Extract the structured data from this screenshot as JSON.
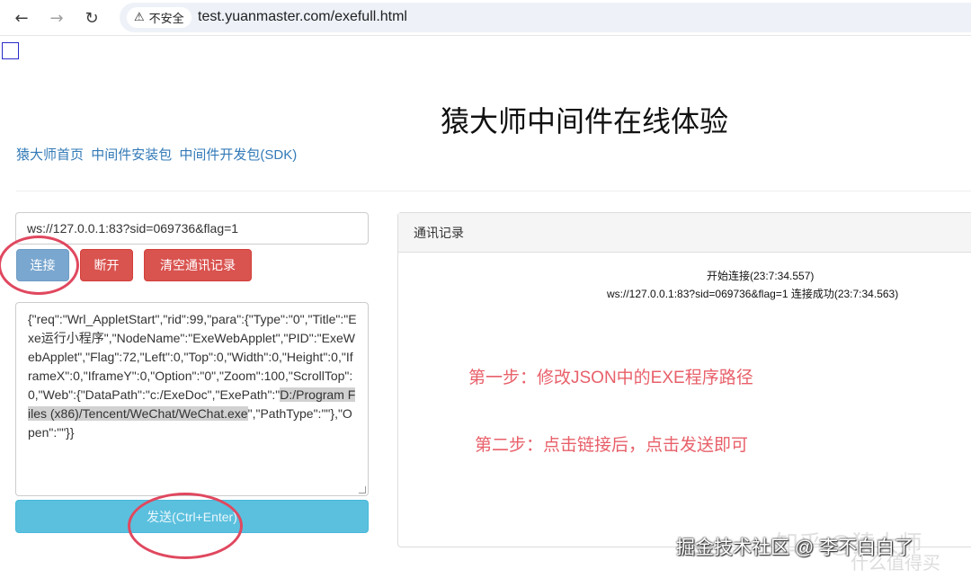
{
  "browser": {
    "back_icon": "arrow-left-icon",
    "forward_icon": "arrow-right-icon",
    "reload_icon": "reload-icon",
    "security_label": "不安全",
    "url": "test.yuanmaster.com/exefull.html"
  },
  "page": {
    "title": "猿大师中间件在线体验",
    "links": [
      "猿大师首页",
      "中间件安装包",
      "中间件开发包(SDK)"
    ],
    "ws_url": "ws://127.0.0.1:83?sid=069736&flag=1",
    "buttons": {
      "connect": "连接",
      "disconnect": "断开",
      "clear_log": "清空通讯记录",
      "send": "发送(Ctrl+Enter)"
    },
    "request": {
      "before_selection": "{\"req\":\"Wrl_AppletStart\",\"rid\":99,\"para\":{\"Type\":\"0\",\"Title\":\"Exe运行小程序\",\"NodeName\":\"ExeWebApplet\",\"PID\":\"ExeWebApplet\",\"Flag\":72,\"Left\":0,\"Top\":0,\"Width\":0,\"Height\":0,\"IframeX\":0,\"IframeY\":0,\"Option\":\"0\",\"Zoom\":100,\"ScrollTop\":0,\"Web\":{\"DataPath\":\"c:/ExeDoc\",\"ExePath\":\"",
      "selected": "D:/Program Files (x86)/Tencent/WeChat/WeChat.exe",
      "after_selection": "\",\"PathType\":\"\"},\"Open\":\"\"}}"
    },
    "log_panel": {
      "heading": "通讯记录",
      "lines": [
        "开始连接(23:7:34.557)",
        "ws://127.0.0.1:83?sid=069736&flag=1 连接成功(23:7:34.563)"
      ]
    },
    "annotations": {
      "step1": "第一步：修改JSON中的EXE程序路径",
      "step2": "第二步：点击链接后，点击发送即可",
      "color": "#e8606a"
    }
  },
  "watermarks": {
    "zhihu": "知乎 @猿大师",
    "juejin": "掘金技术社区 @ 李不白白了",
    "smzdm": "什么值得买"
  },
  "colors": {
    "primary": "#7aa7cf",
    "danger": "#d9534f",
    "info": "#5bc0de",
    "link": "#337ab7",
    "annotation_circle": "#e0485f"
  }
}
